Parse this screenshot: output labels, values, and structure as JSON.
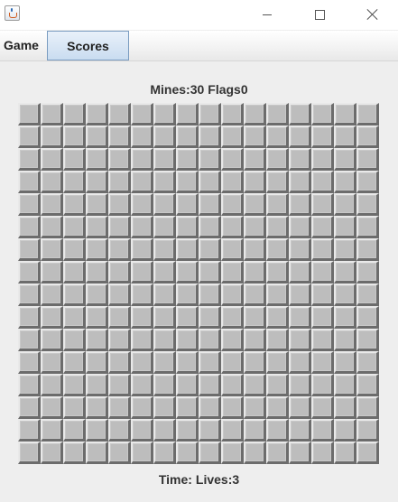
{
  "window": {
    "icon": "java-cup-icon",
    "buttons": [
      "minimize",
      "maximize",
      "close"
    ]
  },
  "menu": {
    "items": [
      {
        "label": "Game",
        "selected": false
      },
      {
        "label": "Scores",
        "selected": true
      }
    ]
  },
  "status": {
    "mines": "Mines:30",
    "flags": "Flags0",
    "time": "Time:",
    "lives": "Lives:3"
  },
  "board": {
    "rows": 16,
    "cols": 16,
    "cell_state": "covered"
  },
  "colors": {
    "background": "#eeeeee",
    "cell": "#bdbdbd",
    "menu_selected": "#c9dcf0"
  }
}
